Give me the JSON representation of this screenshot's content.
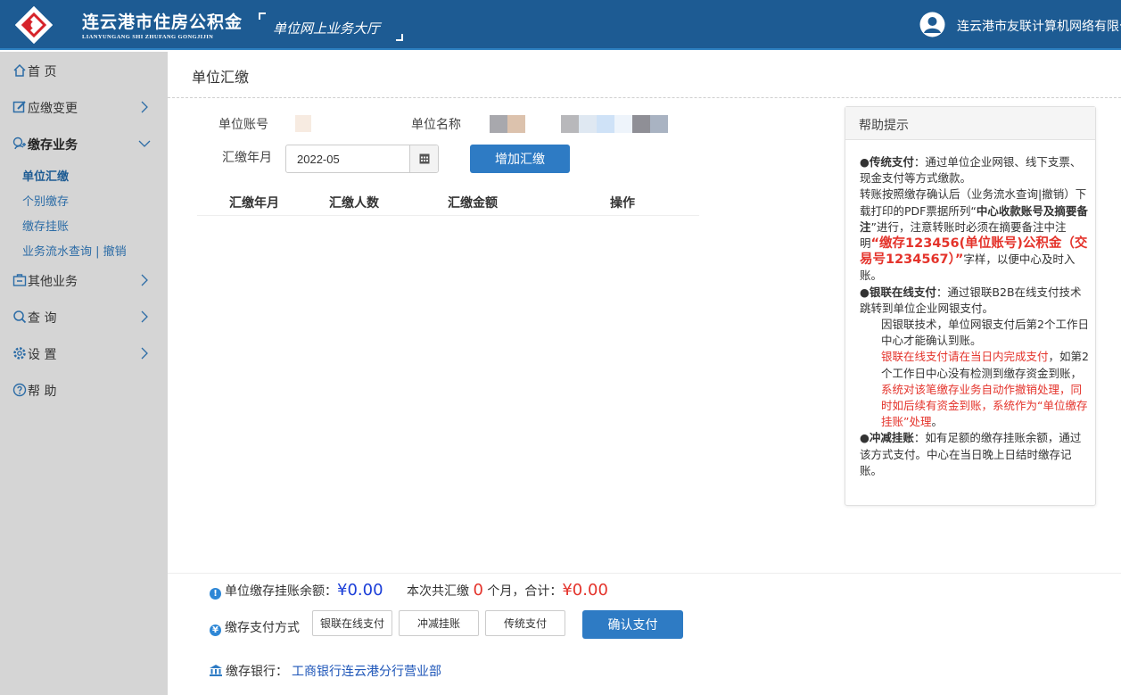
{
  "header": {
    "brand_cn": "连云港市住房公积金",
    "brand_en": "LIANYUNGANG SHI ZHUFANG GONGJIJIN",
    "hall": "单位网上业务大厅",
    "user": "连云港市友联计算机网络有限公"
  },
  "sidebar": {
    "items": [
      {
        "label": "首 页",
        "icon": "home-icon"
      },
      {
        "label": "应缴变更",
        "icon": "edit-icon"
      },
      {
        "label": "缴存业务",
        "icon": "deposit-icon"
      },
      {
        "label": "其他业务",
        "icon": "briefcase-icon"
      },
      {
        "label": "查 询",
        "icon": "search-icon"
      },
      {
        "label": "设 置",
        "icon": "gear-icon"
      },
      {
        "label": "帮 助",
        "icon": "help-icon"
      }
    ],
    "sub_items": [
      "单位汇缴",
      "个别缴存",
      "缴存挂账",
      "业务流水查询 | 撤销"
    ]
  },
  "main": {
    "title": "单位汇缴",
    "account_label": "单位账号",
    "name_label": "单位名称",
    "month_label": "汇缴年月",
    "month_value": "2022-05",
    "add_button": "增加汇缴",
    "table_headers": [
      "汇缴年月",
      "汇缴人数",
      "汇缴金额",
      "操作"
    ]
  },
  "help": {
    "title": "帮助提示",
    "p1_title": "●传统支付",
    "p1_text": "：通过单位企业网银、线下支票、现金支付等方式缴款。",
    "p2_a": "转账按照缴存确认后（业务流水查询|撤销）下载打印的PDF票据所列“",
    "p2_b": "中心收款账号及摘要备注",
    "p2_c": "”进行，注意转账时必须在摘要备注中注明",
    "p2_red": "“缴存123456(单位账号)公积金（交易号1234567）”",
    "p2_d": "字样，以便中心及时入账。",
    "p3_title": "●银联在线支付",
    "p3_text": "：通过银联B2B在线支付技术跳转到单位企业网银支付。",
    "p4": "因银联技术，单位网银支付后第2个工作日中心才能确认到账。",
    "p5_red1": "银联在线支付请在当日内完成支付",
    "p5_b": "，如第2个工作日中心没有检测到缴存资金到账，",
    "p5_red2": "系统对该笔缴存业务自动作撤销处理，同时如后续有资金到账，系统作为“单位缴存挂账”处理",
    "p5_end": "。",
    "p6_title": "●冲减挂账",
    "p6_text": "：如有足额的缴存挂账余额，通过该方式支付。中心在当日晚上日结时缴存记账。"
  },
  "bottom": {
    "balance_label": "单位缴存挂账余额：",
    "balance_value": "¥0.00",
    "count_prefix": "本次共汇缴",
    "count_value": "0",
    "count_suffix": "个月，合计：",
    "total_value": "¥0.00",
    "pay_label": "缴存支付方式",
    "pay_options": [
      "银联在线支付",
      "冲减挂账",
      "传统支付"
    ],
    "confirm": "确认支付",
    "bank_label": "缴存银行：",
    "bank_name": "工商银行连云港分行营业部"
  },
  "colors": {
    "header": "#1d5b93",
    "accent": "#2e7bc4",
    "sidebar": "#d5d5d5",
    "red": "#e4332b"
  }
}
